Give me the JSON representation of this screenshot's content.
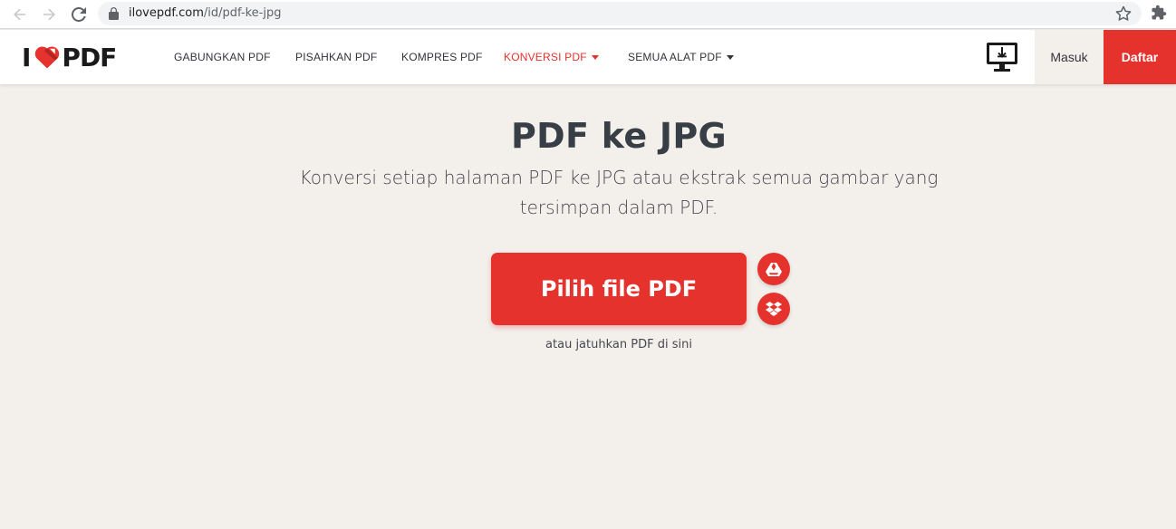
{
  "browser": {
    "url_host": "ilovepdf.com",
    "url_path": "/id/pdf-ke-jpg",
    "icons": [
      "back-arrow-icon",
      "forward-arrow-icon",
      "reload-icon",
      "lock-icon",
      "star-icon",
      "puzzle-icon"
    ]
  },
  "header": {
    "logo": {
      "left": "I",
      "right": "PDF",
      "heart_icon": "heart-icon"
    },
    "menu": [
      {
        "label": "GABUNGKAN PDF",
        "active": false
      },
      {
        "label": "PISAHKAN PDF",
        "active": false
      },
      {
        "label": "KOMPRES PDF",
        "active": false
      },
      {
        "label": "KONVERSI PDF",
        "active": true,
        "dropdown": true
      },
      {
        "label": "SEMUA ALAT PDF",
        "active": false,
        "dropdown": true
      }
    ],
    "desktop_icon": "desktop-download-icon",
    "login_label": "Masuk",
    "signup_label": "Daftar"
  },
  "main": {
    "title": "PDF ke JPG",
    "subtitle": "Konversi setiap halaman PDF ke JPG atau ekstrak semua gambar yang tersimpan dalam PDF.",
    "select_button_label": "Pilih file PDF",
    "cloud_buttons": [
      "google-drive-icon",
      "dropbox-icon"
    ],
    "drop_hint": "atau jatuhkan PDF di sini"
  },
  "colors": {
    "brand_red": "#e5322d",
    "page_background": "#f3f0ec",
    "text_dark": "#383e45"
  }
}
